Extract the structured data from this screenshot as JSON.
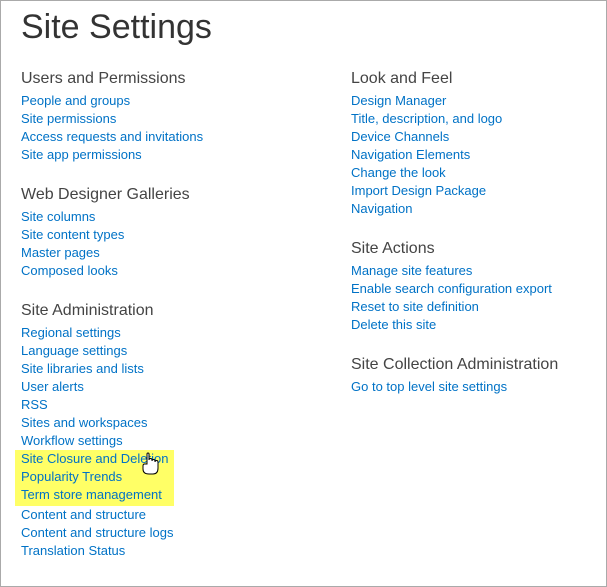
{
  "page_title": "Site Settings",
  "left": [
    {
      "heading": "Users and Permissions",
      "links": [
        "People and groups",
        "Site permissions",
        "Access requests and invitations",
        "Site app permissions"
      ]
    },
    {
      "heading": "Web Designer Galleries",
      "links": [
        "Site columns",
        "Site content types",
        "Master pages",
        "Composed looks"
      ]
    },
    {
      "heading": "Site Administration",
      "links": [
        "Regional settings",
        "Language settings",
        "Site libraries and lists",
        "User alerts",
        "RSS",
        "Sites and workspaces",
        "Workflow settings",
        "Site Closure and Deletion",
        "Popularity Trends",
        "Term store management",
        "Content and structure",
        "Content and structure logs",
        "Translation Status"
      ],
      "highlight_from": 7,
      "highlight_to": 9,
      "cursor_on": 8
    }
  ],
  "right": [
    {
      "heading": "Look and Feel",
      "links": [
        "Design Manager",
        "Title, description, and logo",
        "Device Channels",
        "Navigation Elements",
        "Change the look",
        "Import Design Package",
        "Navigation"
      ]
    },
    {
      "heading": "Site Actions",
      "links": [
        "Manage site features",
        "Enable search configuration export",
        "Reset to site definition",
        "Delete this site"
      ]
    },
    {
      "heading": "Site Collection Administration",
      "links": [
        "Go to top level site settings"
      ]
    }
  ]
}
